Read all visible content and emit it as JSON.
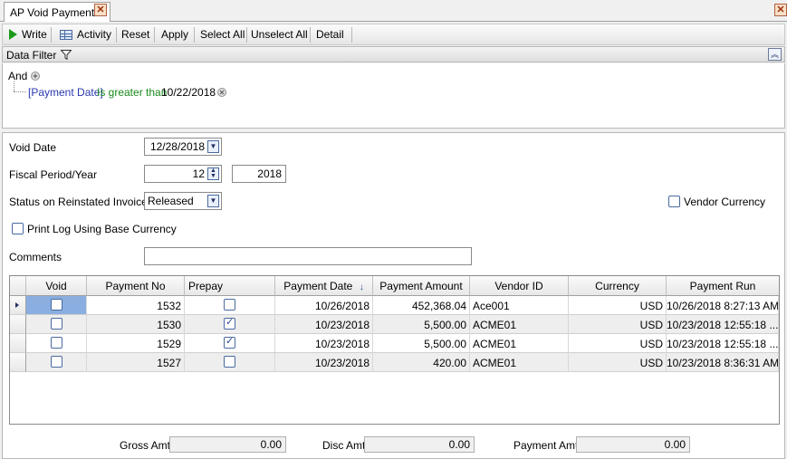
{
  "tab": {
    "title": "AP Void Payments",
    "close_glyph": "✕"
  },
  "window": {
    "close_glyph": "✕"
  },
  "toolbar": {
    "write": "Write",
    "activity": "Activity",
    "reset": "Reset",
    "apply": "Apply",
    "select_all": "Select All",
    "unselect_all": "Unselect All",
    "detail": "Detail"
  },
  "filter": {
    "title": "Data Filter",
    "collapse_glyph": "︽",
    "group": "And",
    "condition": {
      "field": "[Payment Date]",
      "operator": "Is greater than",
      "value": "10/22/2018"
    }
  },
  "form": {
    "void_date_label": "Void Date",
    "void_date": "12/28/2018",
    "fiscal_label": "Fiscal Period/Year",
    "fiscal_period": "12",
    "fiscal_year": "2018",
    "status_label": "Status on Reinstated Invoices",
    "status": "Released",
    "vendor_currency_label": "Vendor Currency",
    "vendor_currency": false,
    "print_log_label": "Print Log Using Base Currency",
    "print_log": false,
    "comments_label": "Comments",
    "comments": ""
  },
  "grid": {
    "columns": [
      "Void",
      "Payment No",
      "Prepay",
      "Payment Date",
      "Payment Amount",
      "Vendor ID",
      "Currency",
      "Payment Run"
    ],
    "rows": [
      {
        "void": false,
        "payment_no": "1532",
        "prepay": false,
        "payment_date": "10/26/2018",
        "amount": "452,368.04",
        "vendor": "Ace001",
        "currency": "USD",
        "run": "10/26/2018 8:27:13 AM"
      },
      {
        "void": false,
        "payment_no": "1530",
        "prepay": true,
        "payment_date": "10/23/2018",
        "amount": "5,500.00",
        "vendor": "ACME01",
        "currency": "USD",
        "run": "10/23/2018 12:55:18 ..."
      },
      {
        "void": false,
        "payment_no": "1529",
        "prepay": true,
        "payment_date": "10/23/2018",
        "amount": "5,500.00",
        "vendor": "ACME01",
        "currency": "USD",
        "run": "10/23/2018 12:55:18 ..."
      },
      {
        "void": false,
        "payment_no": "1527",
        "prepay": false,
        "payment_date": "10/23/2018",
        "amount": "420.00",
        "vendor": "ACME01",
        "currency": "USD",
        "run": "10/23/2018 8:36:31 AM"
      }
    ]
  },
  "totals": {
    "gross_label": "Gross Amt",
    "gross": "0.00",
    "disc_label": "Disc Amt",
    "disc": "0.00",
    "payment_label": "Payment Amt",
    "payment": "0.00"
  },
  "colors": {
    "accent": "#4a6aa0",
    "filter_field": "#2a3ab0",
    "filter_operator": "#1a8a1a",
    "selected_cell": "#8aaee0"
  }
}
